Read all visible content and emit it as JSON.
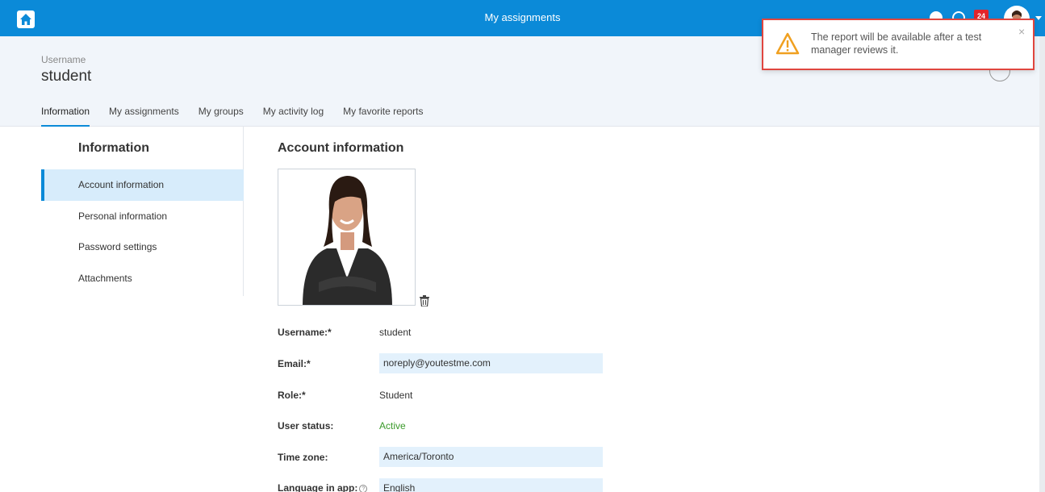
{
  "app": {
    "title": "My assignments",
    "badge_count": "24"
  },
  "profile": {
    "username_label": "Username",
    "username": "student"
  },
  "tabs": [
    {
      "label": "Information",
      "active": true
    },
    {
      "label": "My assignments"
    },
    {
      "label": "My groups"
    },
    {
      "label": "My activity log"
    },
    {
      "label": "My favorite reports"
    }
  ],
  "sidebar": {
    "title": "Information",
    "items": [
      {
        "label": "Account information",
        "active": true
      },
      {
        "label": "Personal information"
      },
      {
        "label": "Password settings"
      },
      {
        "label": "Attachments"
      }
    ]
  },
  "account": {
    "title": "Account information",
    "fields": {
      "username": {
        "label": "Username:*",
        "value": "student"
      },
      "email": {
        "label": "Email:*",
        "value": "noreply@youtestme.com"
      },
      "role": {
        "label": "Role:*",
        "value": "Student"
      },
      "status": {
        "label": "User status:",
        "value": "Active"
      },
      "timezone": {
        "label": "Time zone:",
        "value": "America/Toronto"
      },
      "language": {
        "label": "Language in app:",
        "value": "English"
      }
    }
  },
  "notification": {
    "message": "The report will be available after a test manager reviews it.",
    "close_glyph": "×"
  },
  "colors": {
    "accent": "#0b8ad8",
    "active_status": "#3a9a2a",
    "alert_border": "#e0463f",
    "warning": "#f0a020"
  }
}
